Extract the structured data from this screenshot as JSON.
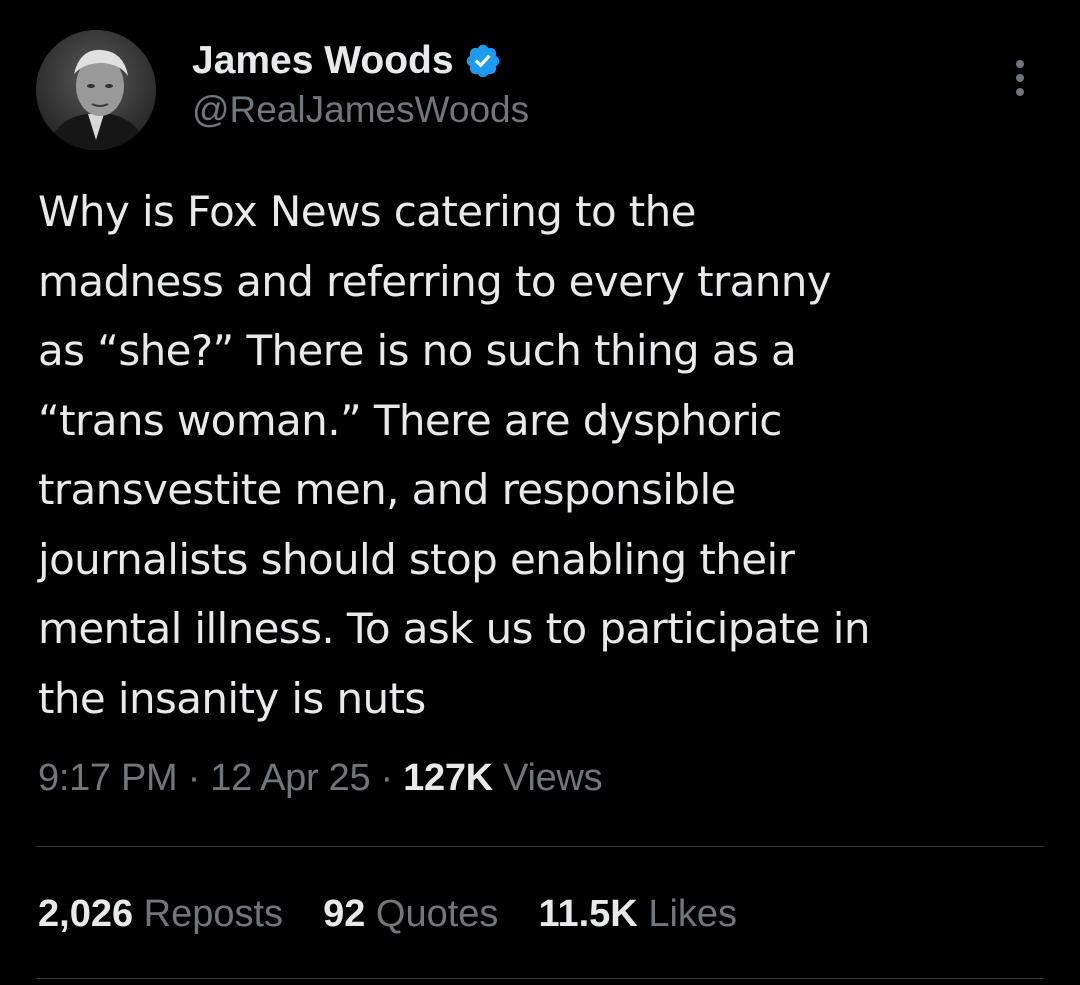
{
  "author": {
    "display_name": "James Woods",
    "handle": "@RealJamesWoods",
    "verified_icon": "verified-badge-icon",
    "verified_color": "#1d9bf0"
  },
  "tweet": {
    "text_lines": [
      "Why is Fox News catering to the",
      "madness and referring to every tranny",
      "as “she?” There is no such thing as a",
      "“trans woman.” There are dysphoric",
      "transvestite men, and responsible",
      "journalists should stop enabling their",
      "mental illness. To ask us to participate in",
      "the insanity is nuts"
    ]
  },
  "meta": {
    "time": "9:17 PM",
    "separator": " · ",
    "date": "12 Apr 25",
    "views_count": "127K",
    "views_label": "Views"
  },
  "stats": {
    "reposts_count": "2,026",
    "reposts_label": "Reposts",
    "quotes_count": "92",
    "quotes_label": "Quotes",
    "likes_count": "11.5K",
    "likes_label": "Likes"
  },
  "colors": {
    "background": "#000000",
    "primary_text": "#e7e9ea",
    "secondary_text": "#71767b",
    "divider": "#2f3336"
  }
}
